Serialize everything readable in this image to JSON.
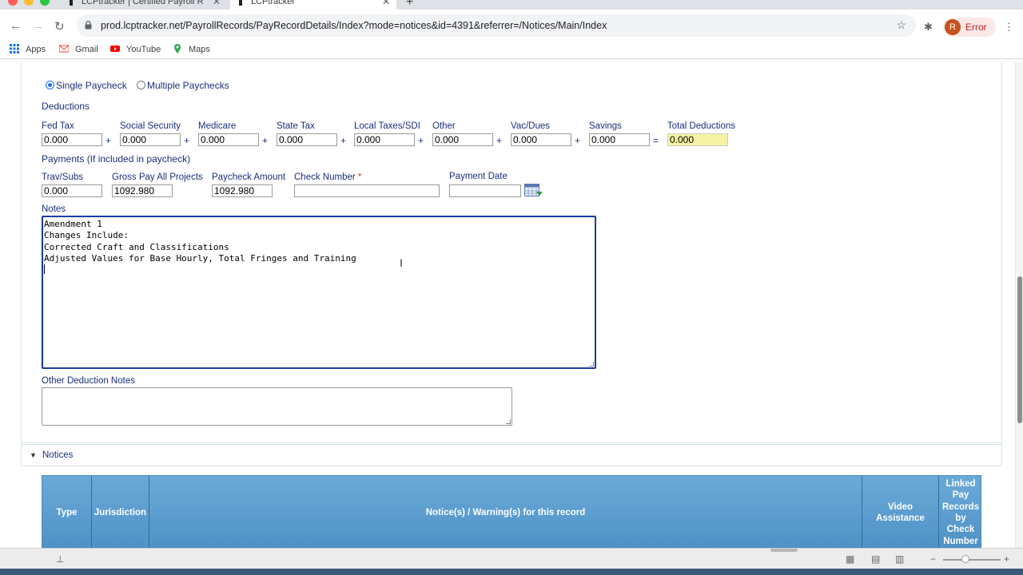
{
  "browser": {
    "tabs": [
      {
        "title": "LCPtracker | Certified Payroll R"
      },
      {
        "title": "LCPtracker"
      }
    ],
    "url": "prod.lcptracker.net/PayrollRecords/PayRecordDetails/Index?mode=notices&id=4391&referrer=/Notices/Main/Index",
    "profile_initial": "R",
    "profile_status": "Error",
    "bookmarks": [
      {
        "label": "Apps",
        "icon": "apps-grid-icon"
      },
      {
        "label": "Gmail",
        "icon": "gmail-icon"
      },
      {
        "label": "YouTube",
        "icon": "youtube-icon"
      },
      {
        "label": "Maps",
        "icon": "maps-icon"
      }
    ]
  },
  "paycheck_type": {
    "single_label": "Single Paycheck",
    "multiple_label": "Multiple Paychecks",
    "selected": "single"
  },
  "deductions": {
    "section_label": "Deductions",
    "fields": [
      {
        "label": "Fed Tax",
        "value": "0.000"
      },
      {
        "label": "Social Security",
        "value": "0.000"
      },
      {
        "label": "Medicare",
        "value": "0.000"
      },
      {
        "label": "State Tax",
        "value": "0.000"
      },
      {
        "label": "Local Taxes/SDI",
        "value": "0.000"
      },
      {
        "label": "Other",
        "value": "0.000"
      },
      {
        "label": "Vac/Dues",
        "value": "0.000"
      },
      {
        "label": "Savings",
        "value": "0.000"
      }
    ],
    "plus": "+",
    "equals": "=",
    "total": {
      "label": "Total Deductions",
      "value": "0.000"
    }
  },
  "payments": {
    "section_label": "Payments (If included in paycheck)",
    "trav_subs": {
      "label": "Trav/Subs",
      "value": "0.000"
    },
    "gross_pay": {
      "label": "Gross Pay All Projects",
      "value": "1092.980"
    },
    "paycheck_amount": {
      "label": "Paycheck Amount",
      "value": "1092.980"
    },
    "check_number": {
      "label": "Check Number",
      "required_mark": "*",
      "value": ""
    },
    "payment_date": {
      "label": "Payment Date",
      "value": ""
    }
  },
  "notes": {
    "label": "Notes",
    "lines": [
      "Amendment 1",
      "Changes Include:",
      "Corrected Craft and Classifications",
      "Adjusted Values for Base Hourly, Total Fringes and Training"
    ]
  },
  "other_deduction_notes": {
    "label": "Other Deduction Notes",
    "value": ""
  },
  "notices": {
    "section_label": "Notices",
    "columns": [
      "Type",
      "Jurisdiction",
      "Notice(s) / Warning(s) for this record",
      "Video Assistance",
      "Linked Pay Records by Check Number"
    ]
  },
  "colors": {
    "label_text": "#1a2f7a",
    "total_highlight": "#f5f3a3",
    "notes_focus_border": "#1a3c9e",
    "table_header": "#5b9bcf",
    "error_pill": "#c5221f"
  }
}
